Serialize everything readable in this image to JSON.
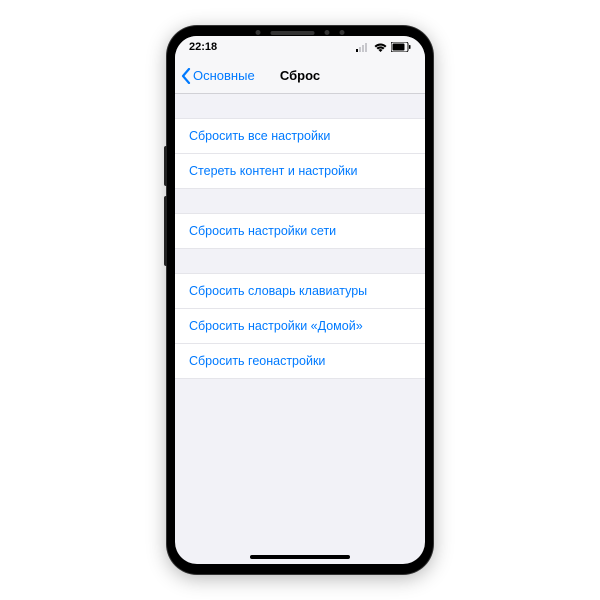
{
  "status": {
    "time": "22:18"
  },
  "nav": {
    "back_label": "Основные",
    "title": "Сброс"
  },
  "groups": [
    {
      "rows": [
        {
          "label": "Сбросить все настройки"
        },
        {
          "label": "Стереть контент и настройки"
        }
      ]
    },
    {
      "rows": [
        {
          "label": "Сбросить настройки сети"
        }
      ]
    },
    {
      "rows": [
        {
          "label": "Сбросить словарь клавиатуры"
        },
        {
          "label": "Сбросить настройки «Домой»"
        },
        {
          "label": "Сбросить геонастройки"
        }
      ]
    }
  ],
  "colors": {
    "accent": "#007aff",
    "background": "#f2f2f7"
  }
}
